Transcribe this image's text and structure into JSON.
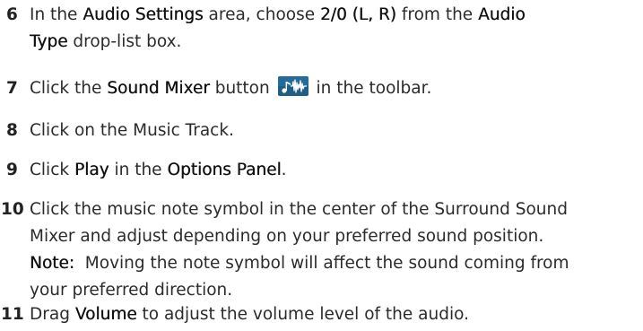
{
  "steps": [
    {
      "number": "6",
      "parts": {
        "a": "In the ",
        "b": "Audio Settings",
        "c": " area, choose ",
        "d": "2/0 (L, R)",
        "e": " from the ",
        "f": "Audio",
        "g": "Type",
        "h": " drop-list box."
      }
    },
    {
      "number": "7",
      "parts": {
        "a": "Click the ",
        "b": "Sound Mixer",
        "c": " button",
        "d": " in the toolbar."
      },
      "icon": "sound-mixer-icon"
    },
    {
      "number": "8",
      "text": "Click on the Music Track."
    },
    {
      "number": "9",
      "parts": {
        "a": "Click ",
        "b": "Play",
        "c": " in the ",
        "d": "Options Panel",
        "e": "."
      }
    },
    {
      "number": "10",
      "line1": "Click the music note symbol in the center of the Surround Sound",
      "line2": "Mixer and adjust depending on your preferred sound position.",
      "note_label": "Note:",
      "note_line1": "  Moving the note symbol will affect the sound coming from",
      "note_line2": "your preferred direction."
    },
    {
      "number": "11",
      "parts": {
        "a": "Drag ",
        "b": "Volume",
        "c": " to adjust the volume level of the audio."
      }
    }
  ],
  "colors": {
    "text": "#2b2b2b",
    "icon_bg": "#1f5e86",
    "icon_fg": "#ffffff"
  }
}
